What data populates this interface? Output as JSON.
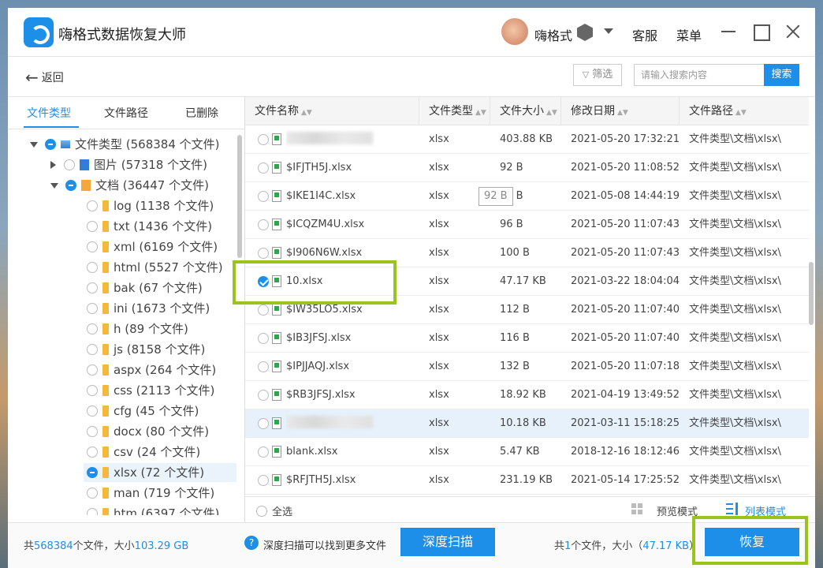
{
  "app": {
    "title": "嗨格式数据恢复大师",
    "username": "嗨格式",
    "service": "客服",
    "menu": "菜单"
  },
  "toolbar": {
    "back": "返回",
    "filter": "筛选",
    "search_placeholder": "请输入搜索内容",
    "search_button": "搜索"
  },
  "left_tabs": [
    "文件类型",
    "文件路径",
    "已删除"
  ],
  "tree": {
    "root": "文件类型 (568384 个文件)",
    "images": "图片 (57318 个文件)",
    "docs": "文档 (36447 个文件)",
    "children": [
      "log (1138 个文件)",
      "txt (1436 个文件)",
      "xml (6169 个文件)",
      "html (5527 个文件)",
      "bak (67 个文件)",
      "ini (1673 个文件)",
      "h (89 个文件)",
      "js (8158 个文件)",
      "aspx (264 个文件)",
      "css (2113 个文件)",
      "cfg (45 个文件)",
      "docx (80 个文件)",
      "csv (24 个文件)",
      "xlsx (72 个文件)",
      "man (719 个文件)",
      "htm (6397 个文件)"
    ]
  },
  "table": {
    "headers": [
      "文件名称",
      "文件类型",
      "文件大小",
      "修改日期",
      "文件路径"
    ],
    "rows": [
      {
        "name": "",
        "type": "xlsx",
        "size": "403.88 KB",
        "date": "2021-05-20 17:32:21",
        "path": "文件类型\\文档\\xlsx\\"
      },
      {
        "name": "$IFJTH5J.xlsx",
        "type": "xlsx",
        "size": "92 B",
        "date": "2021-05-20 11:08:52",
        "path": "文件类型\\文档\\xlsx\\"
      },
      {
        "name": "$IKE1I4C.xlsx",
        "type": "xlsx",
        "size": "92 B",
        "date": "2021-05-08 14:44:19",
        "path": "文件类型\\文档\\xlsx\\"
      },
      {
        "name": "$ICQZM4U.xlsx",
        "type": "xlsx",
        "size": "96 B",
        "date": "2021-05-20 11:07:43",
        "path": "文件类型\\文档\\xlsx\\"
      },
      {
        "name": "$I906N6W.xlsx",
        "type": "xlsx",
        "size": "100 B",
        "date": "2021-05-20 11:07:43",
        "path": "文件类型\\文档\\xlsx\\"
      },
      {
        "name": "10.xlsx",
        "type": "xlsx",
        "size": "47.17 KB",
        "date": "2021-03-22 18:04:04",
        "path": "文件类型\\文档\\xlsx\\"
      },
      {
        "name": "$IW35LO5.xlsx",
        "type": "xlsx",
        "size": "112 B",
        "date": "2021-05-20 11:07:40",
        "path": "文件类型\\文档\\xlsx\\"
      },
      {
        "name": "$IB3JFSJ.xlsx",
        "type": "xlsx",
        "size": "116 B",
        "date": "2021-05-20 11:07:40",
        "path": "文件类型\\文档\\xlsx\\"
      },
      {
        "name": "$IPJJAQJ.xlsx",
        "type": "xlsx",
        "size": "132 B",
        "date": "2021-05-20 11:07:18",
        "path": "文件类型\\文档\\xlsx\\"
      },
      {
        "name": "$RB3JFSJ.xlsx",
        "type": "xlsx",
        "size": "18.92 KB",
        "date": "2021-04-19 13:49:52",
        "path": "文件类型\\文档\\xlsx\\"
      },
      {
        "name": "",
        "type": "xlsx",
        "size": "10.18 KB",
        "date": "2021-03-11 15:18:25",
        "path": "文件类型\\文档\\xlsx\\"
      },
      {
        "name": "blank.xlsx",
        "type": "xlsx",
        "size": "5.47 KB",
        "date": "2018-12-16 18:12:46",
        "path": "文件类型\\文档\\xlsx\\"
      },
      {
        "name": "$RFJTH5J.xlsx",
        "type": "xlsx",
        "size": "231.19 KB",
        "date": "2021-05-14 17:25:52",
        "path": "文件类型\\文档\\xlsx\\"
      }
    ],
    "tooltip": "92 B"
  },
  "footer": {
    "select_all": "全选",
    "preview_mode": "预览模式",
    "list_mode": "列表模式"
  },
  "bottom": {
    "stat_prefix": "共",
    "stat_count": "568384",
    "stat_mid": "个文件，大小",
    "stat_size": "103.29 GB",
    "deep_hint": "深度扫描可以找到更多文件",
    "deep_button": "深度扫描",
    "sel_prefix": "共",
    "sel_count": "1",
    "sel_mid": "个文件，大小（",
    "sel_size": "47.17 KB",
    "sel_suffix": "）",
    "recover_button": "恢复"
  },
  "colors": {
    "accent": "#1d8fe8",
    "highlight_box": "#9ac31c"
  }
}
